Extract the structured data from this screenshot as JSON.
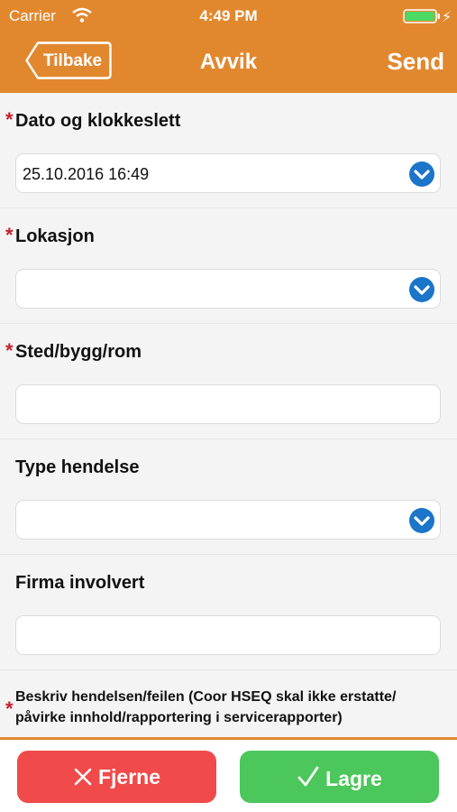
{
  "status_bar": {
    "carrier": "Carrier",
    "time": "4:49 PM"
  },
  "nav": {
    "back_label": "Tilbake",
    "title": "Avvik",
    "send_label": "Send"
  },
  "form": {
    "required_marker": "*",
    "fields": [
      {
        "label": "Dato og klokkeslett",
        "value": "25.10.2016 16:49"
      },
      {
        "label": "Lokasjon",
        "value": ""
      },
      {
        "label": "Sted/bygg/rom",
        "value": ""
      },
      {
        "label": "Type hendelse",
        "value": ""
      },
      {
        "label": "Firma involvert",
        "value": ""
      },
      {
        "label": "Beskriv hendelsen/feilen (Coor HSEQ skal ikke erstatte/ påvirke innhold/rapportering i servicerapporter)",
        "value": ""
      }
    ]
  },
  "actions": {
    "remove_label": "Fjerne",
    "save_label": "Lagre"
  },
  "colors": {
    "brand": "#e1882f",
    "remove": "#f04a4a",
    "save": "#4cc75b",
    "dropdown": "#1b75c9",
    "required": "#c3232f"
  }
}
